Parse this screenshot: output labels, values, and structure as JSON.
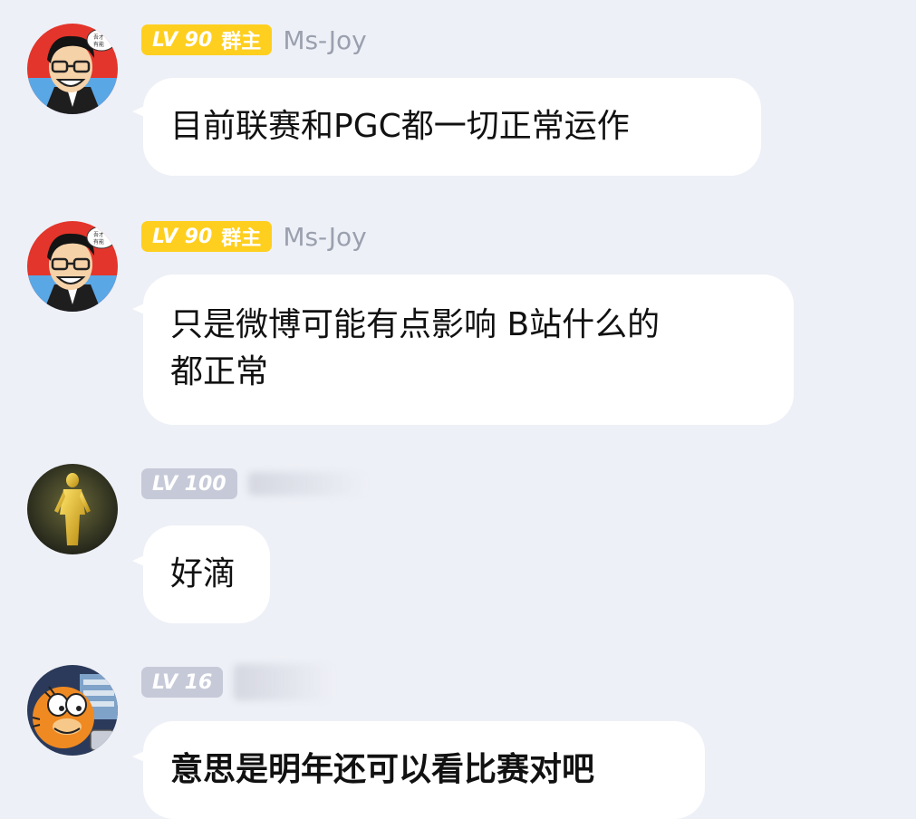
{
  "messages": [
    {
      "level": "LV 90",
      "role": "群主",
      "sender": "Ms-Joy",
      "text": "目前联赛和PGC都一切正常运作",
      "avatar_icon": "cartoon-man-glasses-icon"
    },
    {
      "level": "LV 90",
      "role": "群主",
      "sender": "Ms-Joy",
      "text_line1": "只是微博可能有点影响 B站什么的",
      "text_line2": "都正常",
      "avatar_icon": "cartoon-man-glasses-icon"
    },
    {
      "level": "LV 100",
      "text": "好滴",
      "avatar_icon": "golden-statue-icon"
    },
    {
      "level": "LV 16",
      "text": "意思是明年还可以看比赛对吧",
      "avatar_icon": "cartoon-cat-icon"
    }
  ],
  "colors": {
    "background": "#eef0f7",
    "bubble": "#ffffff",
    "owner_badge": "#ffcf1f",
    "member_badge": "#c6cad8",
    "sender_name": "#9aa0ae"
  }
}
